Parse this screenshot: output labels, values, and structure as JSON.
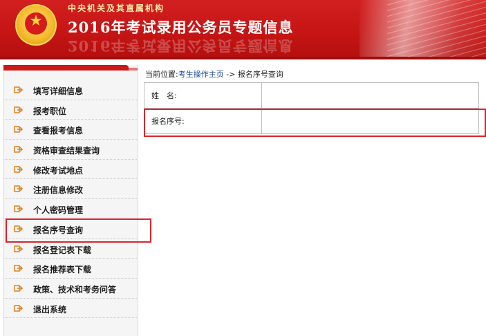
{
  "header": {
    "org_name": "中央机关及其直属机构",
    "title": "2016年考试录用公务员专题信息",
    "colors": {
      "primary": "#c71515",
      "highlight": "#d8262b"
    }
  },
  "sidebar": {
    "items": [
      {
        "label": "填写详细信息",
        "icon": "arrow-right-icon"
      },
      {
        "label": "报考职位",
        "icon": "arrow-right-icon"
      },
      {
        "label": "查看报考信息",
        "icon": "arrow-right-icon"
      },
      {
        "label": "资格审查结果查询",
        "icon": "arrow-right-icon"
      },
      {
        "label": "修改考试地点",
        "icon": "arrow-right-icon"
      },
      {
        "label": "注册信息修改",
        "icon": "arrow-right-icon"
      },
      {
        "label": "个人密码管理",
        "icon": "arrow-right-icon"
      },
      {
        "label": "报名序号查询",
        "icon": "arrow-right-icon",
        "selected": true
      },
      {
        "label": "报名登记表下载",
        "icon": "arrow-right-icon"
      },
      {
        "label": "报名推荐表下载",
        "icon": "arrow-right-icon"
      },
      {
        "label": "政策、技术和考务问答",
        "icon": "arrow-right-icon"
      },
      {
        "label": "退出系统",
        "icon": "arrow-right-icon"
      }
    ]
  },
  "breadcrumb": {
    "prefix": "当前位置:",
    "home": "考生操作主页",
    "separator": "->",
    "current": "报名序号查询"
  },
  "form": {
    "name_label": "姓　名:",
    "name_value": "",
    "serial_label": "报名序号:",
    "serial_value": ""
  }
}
